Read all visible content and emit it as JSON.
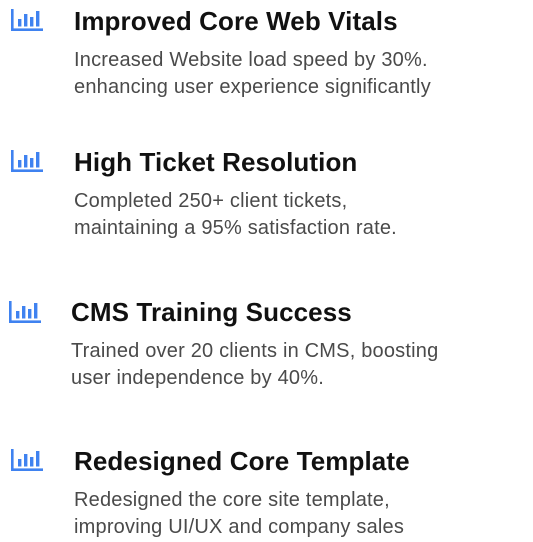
{
  "colors": {
    "icon": "#3f82f0",
    "title": "#111111",
    "description": "#4a4a4a"
  },
  "achievements": [
    {
      "icon": "bar-chart-icon",
      "title": "Improved Core Web Vitals",
      "description_line1": "Increased Website load speed by 30%.",
      "description_line2": "enhancing user experience significantly"
    },
    {
      "icon": "bar-chart-icon",
      "title": "High Ticket Resolution",
      "description_line1": "Completed 250+ client tickets,",
      "description_line2": "maintaining a 95% satisfaction rate."
    },
    {
      "icon": "bar-chart-icon",
      "title": "CMS Training Success",
      "description_line1": "Trained over 20 clients in CMS, boosting",
      "description_line2": "user independence by 40%."
    },
    {
      "icon": "bar-chart-icon",
      "title": "Redesigned Core Template",
      "description_line1": "Redesigned the core site template,",
      "description_line2": "improving UI/UX and company sales"
    }
  ]
}
